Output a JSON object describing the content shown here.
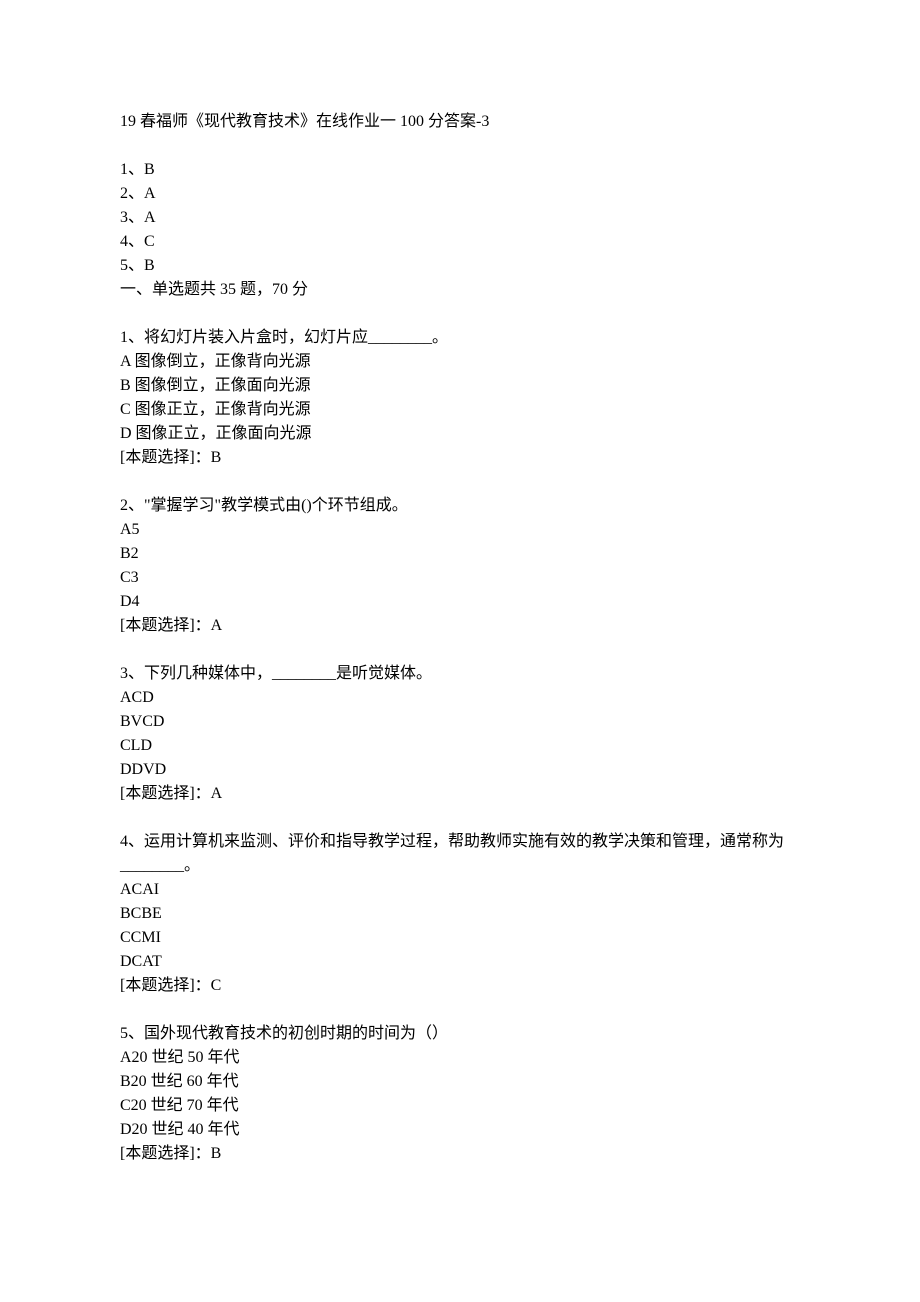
{
  "title": "19 春福师《现代教育技术》在线作业一 100 分答案-3",
  "answer_key": [
    "1、B",
    "2、A",
    "3、A",
    "4、C",
    "5、B"
  ],
  "section_header": "一、单选题共 35 题，70 分",
  "questions": [
    {
      "stem": "1、将幻灯片装入片盒时，幻灯片应________。",
      "options": [
        "A 图像倒立，正像背向光源",
        "B 图像倒立，正像面向光源",
        "C 图像正立，正像背向光源",
        "D 图像正立，正像面向光源"
      ],
      "answer": "[本题选择]：B"
    },
    {
      "stem": "2、\"掌握学习\"教学模式由()个环节组成。",
      "options": [
        "A5",
        "B2",
        "C3",
        "D4"
      ],
      "answer": "[本题选择]：A"
    },
    {
      "stem": "3、下列几种媒体中，________是听觉媒体。",
      "options": [
        "ACD",
        "BVCD",
        "CLD",
        "DDVD"
      ],
      "answer": "[本题选择]：A"
    },
    {
      "stem": "4、运用计算机来监测、评价和指导教学过程，帮助教师实施有效的教学决策和管理，通常称为________。",
      "options": [
        "ACAI",
        "BCBE",
        "CCMI",
        "DCAT"
      ],
      "answer": "[本题选择]：C"
    },
    {
      "stem": "5、国外现代教育技术的初创时期的时间为（）",
      "options": [
        "A20 世纪 50 年代",
        "B20 世纪 60 年代",
        "C20 世纪 70 年代",
        "D20 世纪 40 年代"
      ],
      "answer": "[本题选择]：B"
    }
  ]
}
